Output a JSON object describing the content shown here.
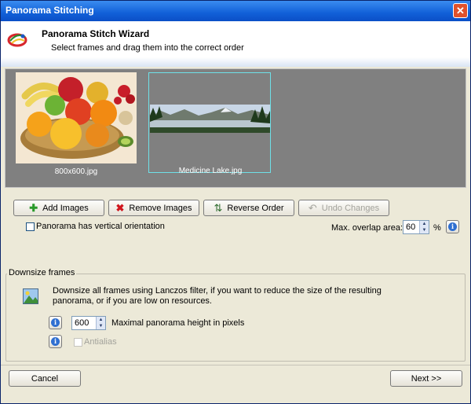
{
  "window": {
    "title": "Panorama Stitching",
    "close_glyph": "✕"
  },
  "header": {
    "title": "Panorama Stitch Wizard",
    "subtitle": "Select frames and drag them into the correct order"
  },
  "frames": [
    {
      "caption": "800x600.jpg"
    },
    {
      "caption": "Medicine Lake.jpg"
    }
  ],
  "toolbar": {
    "add_label": "Add Images",
    "remove_label": "Remove Images",
    "reverse_label": "Reverse Order",
    "undo_label": "Undo Changes"
  },
  "options": {
    "vertical_label": "Panorama has vertical orientation",
    "overlap_label": "Max. overlap area:",
    "overlap_value": "60",
    "overlap_unit": "%"
  },
  "downsize": {
    "legend": "Downsize frames",
    "description_line1": "Downsize all frames using Lanczos filter, if you want to reduce the size of the resulting",
    "description_line2": "panorama, or if you are low on resources.",
    "height_value": "600",
    "height_label": "Maximal panorama height in pixels",
    "antialias_label": "Antialias"
  },
  "footer": {
    "cancel_label": "Cancel",
    "next_label": "Next >>"
  },
  "colors": {
    "titlebar": "#1160d8",
    "frames_bg": "#808080",
    "selection": "#6ee0e8"
  },
  "icons": [
    "logo-icon",
    "plus-icon",
    "remove-x-icon",
    "reverse-order-icon",
    "undo-icon",
    "info-icon",
    "image-icon"
  ]
}
